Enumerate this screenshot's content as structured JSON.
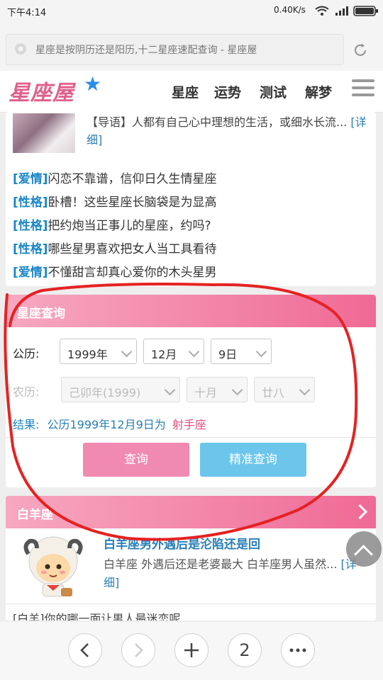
{
  "status_bar": {
    "time": "下午4:14",
    "network_speed": "0.40K/s"
  },
  "browser": {
    "url_text": "星座是按阴历还是阳历,十二星座速配查询 - 星座屋",
    "tab_count": "2"
  },
  "site": {
    "logo": "星座屋",
    "nav": [
      "星座",
      "运势",
      "测试",
      "解梦"
    ]
  },
  "intro": {
    "text": "【导语】人都有自己心中理想的生活，或细水长流...",
    "more": "[详细]"
  },
  "articles": [
    {
      "tag": "[爱情]",
      "title": "闪恋不靠谱，信仰日久生情星座"
    },
    {
      "tag": "[性格]",
      "title": "卧槽！这些星座长脑袋是为显高"
    },
    {
      "tag": "[性格]",
      "title": "把约炮当正事儿的星座，约吗?"
    },
    {
      "tag": "[性格]",
      "title": "哪些星男喜欢把女人当工具看待"
    },
    {
      "tag": "[爱情]",
      "title": "不懂甜言却真心爱你的木头星男"
    }
  ],
  "query": {
    "title": "星座查询",
    "solar_label": "公历:",
    "solar": {
      "year": "1999年",
      "month": "12月",
      "day": "9日"
    },
    "lunar_label": "农历:",
    "lunar": {
      "year": "己卯年(1999)",
      "month": "十月",
      "day": "廿八"
    },
    "result_label": "结果:",
    "result_text": "公历1999年12月9日为",
    "result_sign": "射手座",
    "btn_query": "查询",
    "btn_precise": "精准查询"
  },
  "aries": {
    "title": "白羊座",
    "headline": "白羊座男外遇后是沦陷还是回",
    "desc": "白羊座 外遇后还是老婆最大 白羊座男人虽然...",
    "more": "[详细]",
    "partial": "[白羊]你的哪一面让男人最迷恋呢"
  },
  "colors": {
    "pink": "#ef6a96",
    "blue": "#2a7fb8",
    "annotation": "#e52222"
  }
}
